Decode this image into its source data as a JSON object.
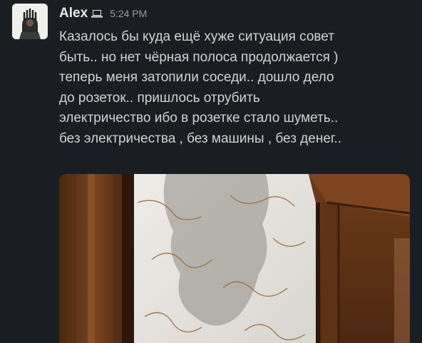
{
  "message": {
    "sender": "Alex",
    "timestamp": "5:24 PM",
    "status_icon": "laptop-icon",
    "avatar_icon": "user-avatar",
    "body_lines": [
      "Казалось бы куда ещё хуже ситуация совет",
      "быть.. но нет чёрная полоса продолжается )",
      "теперь меня затопили соседи.. дошло дело",
      "до розеток.. пришлось отрубить",
      "электричество ибо в розетке стало шуметь..",
      "без электричества , без машины , без денег.."
    ],
    "attachment": {
      "kind": "photo",
      "icon": "image-icon"
    }
  },
  "colors": {
    "background": "#1a1d21",
    "sender": "#e8e8e8",
    "text": "#d1d2d3",
    "timestamp": "#9a9b9d",
    "wood": "#5b3218",
    "wallpaper": "#e4e2dd"
  }
}
